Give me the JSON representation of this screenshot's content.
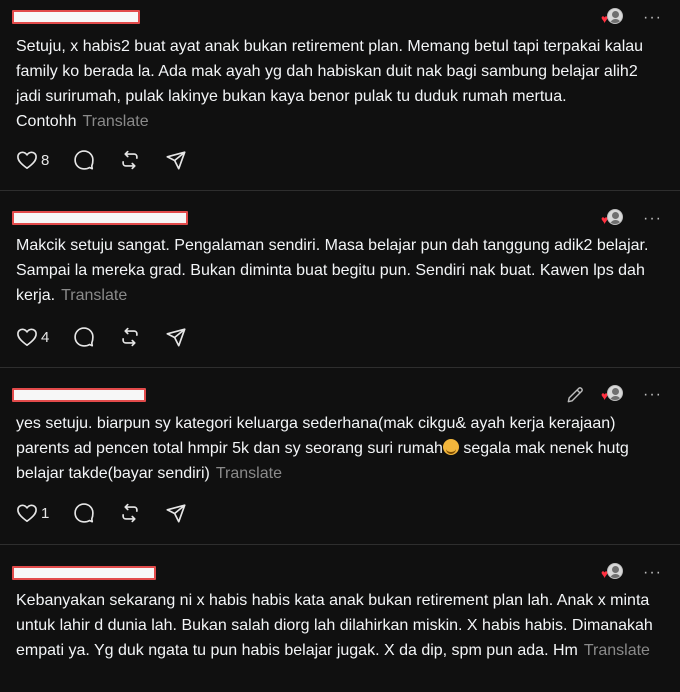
{
  "translate_label": "Translate",
  "posts": [
    {
      "text": "Setuju, x habis2 buat ayat anak bukan retirement plan. Memang betul tapi terpakai kalau family ko berada la. Ada mak ayah yg dah habiskan duit nak bagi sambung belajar alih2 jadi surirumah, pulak lakinye bukan kaya benor pulak tu duduk rumah mertua. Contohh",
      "like_count": "8"
    },
    {
      "text": "Makcik setuju sangat. Pengalaman sendiri. Masa belajar pun dah tanggung adik2 belajar. Sampai la mereka grad. Bukan diminta buat begitu pun. Sendiri nak buat. Kawen lps dah kerja.",
      "like_count": "4"
    },
    {
      "text_before_emoji": "yes setuju. biarpun sy kategori keluarga sederhana(mak cikgu& ayah kerja kerajaan) parents ad pencen total hmpir 5k dan sy seorang suri rumah",
      "text_after_emoji": " segala mak nenek hutg belajar takde(bayar sendiri)",
      "emoji": "smiling-face-emoji",
      "like_count": "1"
    },
    {
      "text": "Kebanyakan sekarang ni x habis habis kata anak bukan retirement plan lah. Anak x minta untuk lahir d dunia lah. Bukan salah diorg lah dilahirkan miskin. X habis habis. Dimanakah empati ya. Yg duk ngata tu pun habis belajar jugak. X da dip, spm pun ada. Hm"
    }
  ],
  "colors": {
    "background": "#101010",
    "text": "#f3f5f7",
    "muted": "#8a8a8a",
    "heart": "#ff3040",
    "redaction_border": "#e24b4b"
  }
}
